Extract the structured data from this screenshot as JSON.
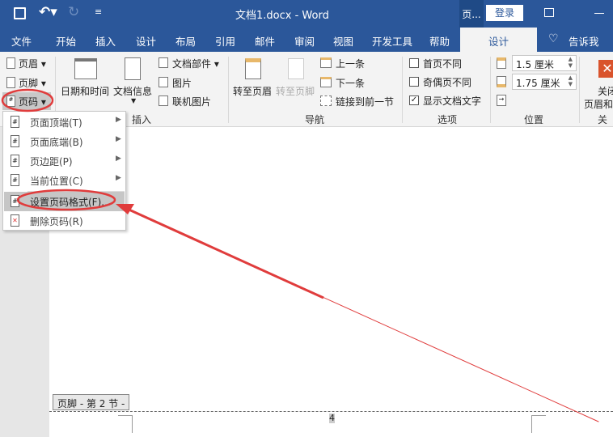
{
  "titlebar": {
    "title": "文档1.docx  -  Word",
    "context_tab": "页...",
    "login": "登录",
    "icons": [
      "save-icon",
      "undo-icon",
      "redo-icon",
      "customize-icon",
      "ribbon-display-icon",
      "minimize-icon"
    ]
  },
  "tabs": [
    "文件",
    "开始",
    "插入",
    "设计",
    "布局",
    "引用",
    "邮件",
    "审阅",
    "视图",
    "开发工具",
    "帮助"
  ],
  "active_tab": "设计",
  "tell_me": "告诉我",
  "ribbon": {
    "header_footer": {
      "header": "页眉",
      "footer": "页脚",
      "page_number": "页码"
    },
    "insert": {
      "date_time": "日期和时间",
      "doc_info": "文档信息",
      "quick_parts": "文档部件",
      "picture": "图片",
      "online_picture": "联机图片",
      "group": "插入"
    },
    "navigation": {
      "goto_header": "转至页眉",
      "goto_footer": "转至页脚",
      "previous": "上一条",
      "next": "下一条",
      "link_previous": "链接到前一节",
      "group": "导航"
    },
    "options": {
      "different_first": "首页不同",
      "different_odd_even": "奇偶页不同",
      "show_text": "显示文档文字",
      "show_text_checked": true,
      "different_first_checked": false,
      "different_odd_even_checked": false,
      "group": "选项"
    },
    "position": {
      "header_top": "1.5 厘米",
      "footer_bottom": "1.75 厘米",
      "group": "位置"
    },
    "close": {
      "label1": "关闭",
      "label2": "页眉和",
      "group": "关闭"
    }
  },
  "menu": {
    "items": [
      {
        "label": "页面顶端(T)",
        "submenu": true
      },
      {
        "label": "页面底端(B)",
        "submenu": true
      },
      {
        "label": "页边距(P)",
        "submenu": true
      },
      {
        "label": "当前位置(C)",
        "submenu": true
      },
      {
        "label": "设置页码格式(F)...",
        "submenu": false,
        "highlighted": true
      },
      {
        "label": "删除页码(R)",
        "submenu": false
      }
    ]
  },
  "document": {
    "footer_tag": "页脚 - 第 2 节 -",
    "page_number": "4"
  },
  "colors": {
    "brand": "#2b579a",
    "annotation": "#e03c3c"
  }
}
